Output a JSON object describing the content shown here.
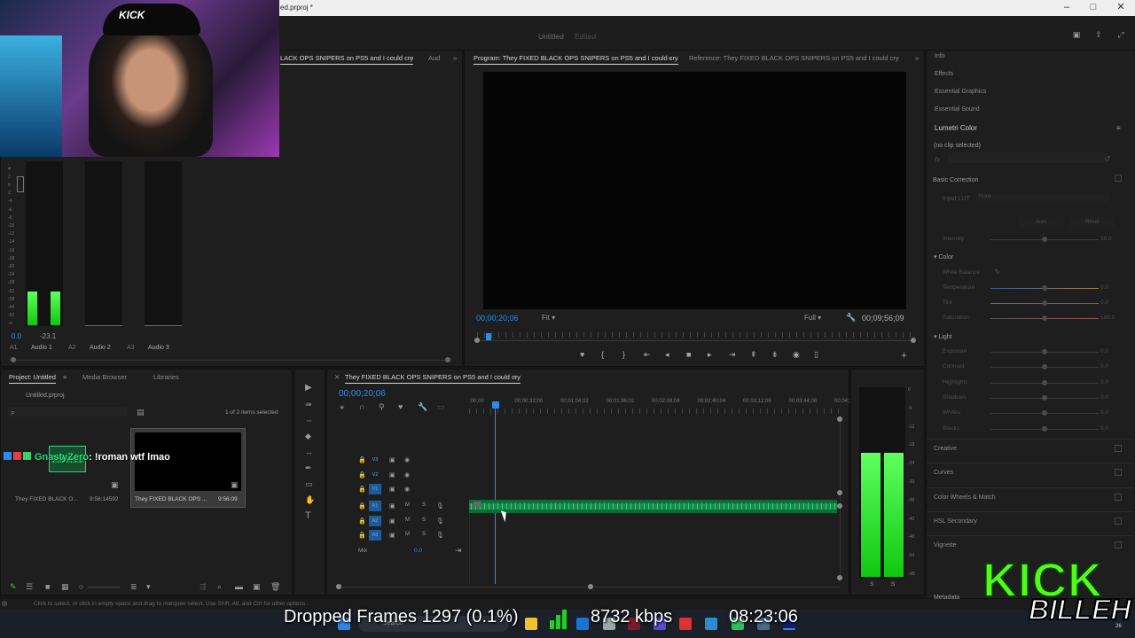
{
  "window": {
    "title_partial": "ed.prproj *",
    "doc_title": "Untitled",
    "doc_state": "Edited"
  },
  "source_panel": {
    "tab_active": "LACK OPS SNIPERS on PS5 and I could cry",
    "tab_menu": "≡",
    "tab_audio": "Aud"
  },
  "audio_mixer": {
    "scale": [
      "-",
      "4",
      "-",
      "2",
      "-",
      "0",
      "-",
      "2",
      "-",
      "-4",
      "-",
      "-6",
      "-",
      "-8",
      "-",
      "-10",
      "-",
      "-12",
      "-",
      "-14",
      "-",
      "-16",
      "-",
      "-18",
      "-",
      "-20",
      "-",
      "-24",
      "-",
      "-28",
      "-",
      "-32",
      "-",
      "-38",
      "-",
      "-44",
      "-",
      "-52",
      "-",
      "-∞"
    ],
    "readout_left": "0.0",
    "readout_right": "-23.1",
    "tracks": [
      {
        "id": "A1",
        "name": "Audio 1"
      },
      {
        "id": "A2",
        "name": "Audio 2"
      },
      {
        "id": "A3",
        "name": "Audio 3"
      }
    ]
  },
  "program": {
    "tab_label": "Program: They FIXED BLACK OPS SNIPERS on PS5 and I could cry",
    "reference_label": "Reference: They FIXED BLACK OPS SNIPERS on PS5 and I could cry",
    "timecode": "00;00;20;06",
    "fit": "Fit",
    "quality": "Full",
    "duration": "00;09;56;09"
  },
  "right_panel": {
    "items": [
      "Info",
      "Effects",
      "Essential Graphics",
      "Essential Sound"
    ],
    "lumetri_title": "Lumetri Color",
    "no_clip": "(no clip selected)",
    "fx": "fx",
    "basic_correction": "Basic Correction",
    "input_lut": "Input LUT",
    "input_lut_val": "None",
    "auto": "Auto",
    "reset": "Reset",
    "intensity": "Intensity",
    "intensity_val": "10.0",
    "color": "Color",
    "white_balance": "White Balance",
    "color_rows": [
      {
        "label": "Temperature",
        "val": "0.0"
      },
      {
        "label": "Tint",
        "val": "0.0"
      },
      {
        "label": "Saturation",
        "val": "100.0"
      }
    ],
    "light": "Light",
    "light_rows": [
      {
        "label": "Exposure",
        "val": "0.0"
      },
      {
        "label": "Contrast",
        "val": "0.0"
      },
      {
        "label": "Highlights",
        "val": "0.0"
      },
      {
        "label": "Shadows",
        "val": "0.0"
      },
      {
        "label": "Whites",
        "val": "0.0"
      },
      {
        "label": "Blacks",
        "val": "0.0"
      }
    ],
    "sections": [
      "Creative",
      "Curves",
      "Color Wheels & Match",
      "HSL Secondary",
      "Vignette"
    ],
    "metadata": "Metadata"
  },
  "project": {
    "tab": "Project: Untitled",
    "tab_media": "Media Browser",
    "tab_libraries": "Libraries",
    "file": "Untitled.prproj",
    "count": "1 of 2 items selected",
    "items": [
      {
        "name": "They FIXED BLACK O...",
        "dur": "9:56:14592"
      },
      {
        "name": "They FIXED BLACK OPS ...",
        "dur": "9:56:09"
      }
    ]
  },
  "timeline": {
    "tab": "They FIXED BLACK OPS SNIPERS on PS5 and I could cry",
    "timecode": "00;00;20;06",
    "ruler": [
      ":00;00",
      "00;00;32;00",
      "00;01;04;02",
      "00;01;36;02",
      "00;02;08;04",
      "00;02;40;04",
      "00;03;12;06",
      "00;03;44;06",
      "00;04;1("
    ],
    "video_tracks": [
      "V3",
      "V2",
      "V1"
    ],
    "audio_tracks": [
      "A1",
      "A2",
      "A3"
    ],
    "mix_label": "Mix",
    "mix_val": "0.0",
    "m": "M",
    "s": "S"
  },
  "right_meter": {
    "scale": [
      "0",
      "-6",
      "-12",
      "-18",
      "-24",
      "-30",
      "-36",
      "-42",
      "-48",
      "-54",
      "-dB"
    ],
    "bottom": [
      "S",
      "S"
    ]
  },
  "status_bar": {
    "hint": "Click to select, or click in empty space and drag to marquee select. Use Shift, Alt, and Ctrl for other options."
  },
  "stream_overlay": {
    "chat_user": "GnastyZero",
    "chat_msg": ": !roman wtf lmao",
    "dropped_frames": "Dropped Frames 1297 (0.1%)",
    "bitrate": "8732 kbps",
    "clock": "08:23:06",
    "logo_top": "KICK",
    "logo_bottom": "BILLEH",
    "webcam_logo": "KICK"
  },
  "taskbar": {
    "search": "Search",
    "corner_num": "26"
  },
  "colors": {
    "accent": "#2d8ceb",
    "meter_green": "#21e021",
    "wave_green": "#2fd37a",
    "kick_green": "#53fc18"
  }
}
